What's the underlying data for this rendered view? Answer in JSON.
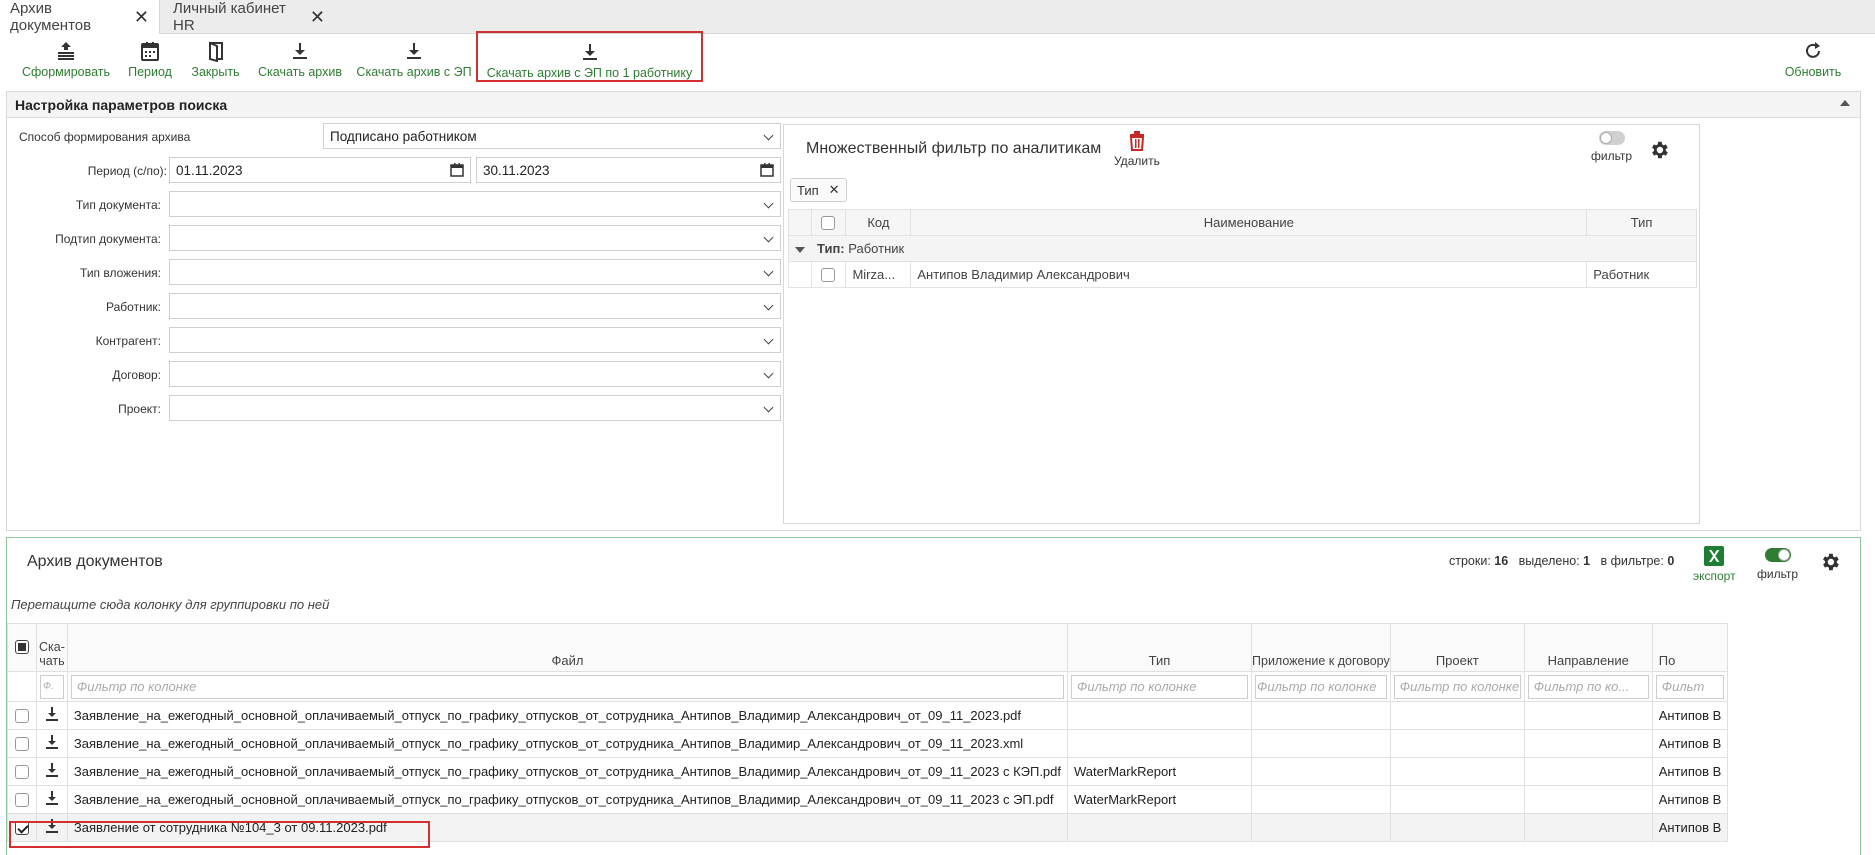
{
  "tabs": [
    {
      "label": "Архив документов",
      "active": true
    },
    {
      "label": "Личный кабинет HR",
      "active": false
    }
  ],
  "toolbar": {
    "form": "Сформировать",
    "period": "Период",
    "close": "Закрыть",
    "download_archive": "Скачать архив",
    "download_archive_ep": "Скачать архив с ЭП",
    "download_archive_ep_one": "Скачать архив с ЭП по 1 работнику",
    "refresh": "Обновить"
  },
  "search_panel": {
    "title": "Настройка параметров поиска",
    "method_label": "Способ формирования архива",
    "method_value": "Подписано работником",
    "period_label": "Период (с/по):",
    "period_from": "01.11.2023",
    "period_to": "30.11.2023",
    "fields": [
      {
        "label": "Тип документа:",
        "value": ""
      },
      {
        "label": "Подтип документа:",
        "value": ""
      },
      {
        "label": "Тип вложения:",
        "value": ""
      },
      {
        "label": "Работник:",
        "value": ""
      },
      {
        "label": "Контрагент:",
        "value": ""
      },
      {
        "label": "Договор:",
        "value": ""
      },
      {
        "label": "Проект:",
        "value": ""
      }
    ]
  },
  "multi_filter": {
    "title": "Множественный фильтр по аналитикам",
    "delete_label": "Удалить",
    "filter_label": "фильтр",
    "chip": "Тип",
    "columns": [
      "Код",
      "Наименование",
      "Тип"
    ],
    "group_prefix": "Тип:",
    "group_value": "Работник",
    "rows": [
      {
        "code": "Mirza...",
        "name": "Антипов Владимир Александрович",
        "type": "Работник"
      }
    ]
  },
  "archive": {
    "title": "Архив документов",
    "rows_label": "строки:",
    "rows_count": "16",
    "selected_label": "выделено:",
    "selected_count": "1",
    "in_filter_label": "в фильтре:",
    "in_filter_count": "0",
    "export_label": "экспорт",
    "filter_label": "фильтр",
    "group_hint": "Перетащите сюда колонку для группировки по ней",
    "columns": {
      "download": "Ска-\nчать",
      "file": "Файл",
      "type": "Тип",
      "attachment": "Приложение к договору",
      "project": "Проект",
      "direction": "Направление",
      "employee": "По"
    },
    "filter_placeholders": {
      "download": "Ф.",
      "file": "Фильтр по колонке",
      "type": "Фильтр по колонке",
      "attachment": "Фильтр по колонке",
      "project": "Фильтр по колонке",
      "direction": "Фильтр по ко...",
      "employee": "Фильт"
    },
    "rows": [
      {
        "file": "Заявление_на_ежегодный_основной_оплачиваемый_отпуск_по_графику_отпусков_от_сотрудника_Антипов_Владимир_Александрович_от_09_11_2023.pdf",
        "type": "",
        "employee": "Антипов В",
        "checked": false
      },
      {
        "file": "Заявление_на_ежегодный_основной_оплачиваемый_отпуск_по_графику_отпусков_от_сотрудника_Антипов_Владимир_Александрович_от_09_11_2023.xml",
        "type": "",
        "employee": "Антипов В",
        "checked": false
      },
      {
        "file": "Заявление_на_ежегодный_основной_оплачиваемый_отпуск_по_графику_отпусков_от_сотрудника_Антипов_Владимир_Александрович_от_09_11_2023 с КЭП.pdf",
        "type": "WaterMarkReport",
        "employee": "Антипов В",
        "checked": false
      },
      {
        "file": "Заявление_на_ежегодный_основной_оплачиваемый_отпуск_по_графику_отпусков_от_сотрудника_Антипов_Владимир_Александрович_от_09_11_2023 с ЭП.pdf",
        "type": "WaterMarkReport",
        "employee": "Антипов В",
        "checked": false
      },
      {
        "file": "Заявление от сотрудника №104_3 от 09.11.2023.pdf",
        "type": "",
        "employee": "Антипов В",
        "checked": true
      }
    ]
  },
  "colors": {
    "accent_green": "#2e7d32",
    "highlight_red": "#d32f2f",
    "delete_red": "#c62828"
  }
}
